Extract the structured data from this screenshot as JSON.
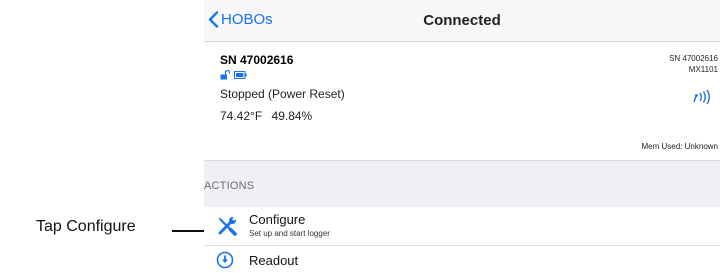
{
  "callout": {
    "text": "Tap Configure"
  },
  "navbar": {
    "back_label": "HOBOs",
    "title": "Connected"
  },
  "device": {
    "serial": "SN 47002616",
    "status": "Stopped (Power Reset)",
    "temperature": "74.42°F",
    "humidity": "49.84%",
    "serial_right": "SN 47002616",
    "model": "MX1101",
    "memory": "Mem Used: Unknown"
  },
  "actions": {
    "header": "ACTIONS",
    "items": [
      {
        "title": "Configure",
        "subtitle": "Set up and start logger",
        "icon": "wrench-screwdriver-icon"
      },
      {
        "title": "Readout",
        "subtitle": "",
        "icon": "download-circle-icon"
      }
    ]
  },
  "colors": {
    "accent": "#1a73e8",
    "section_bg": "#efeff4"
  }
}
